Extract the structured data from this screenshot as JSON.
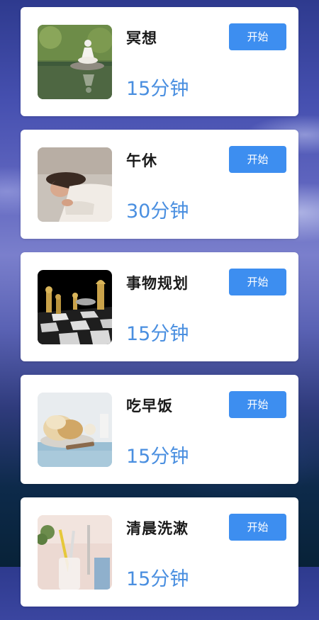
{
  "tasks": [
    {
      "title": "冥想",
      "duration": "15分钟",
      "button": "开始",
      "image": "meditation-image"
    },
    {
      "title": "午休",
      "duration": "30分钟",
      "button": "开始",
      "image": "sleeping-woman-image"
    },
    {
      "title": "事物规划",
      "duration": "15分钟",
      "button": "开始",
      "image": "chess-pieces-image"
    },
    {
      "title": "吃早饭",
      "duration": "15分钟",
      "button": "开始",
      "image": "breakfast-bread-image"
    },
    {
      "title": "清晨洗漱",
      "duration": "15分钟",
      "button": "开始",
      "image": "toothbrush-cup-image"
    }
  ],
  "colors": {
    "accent_button": "#3d8ef0",
    "duration_text": "#4a8fe0",
    "card_bg": "#ffffff"
  }
}
